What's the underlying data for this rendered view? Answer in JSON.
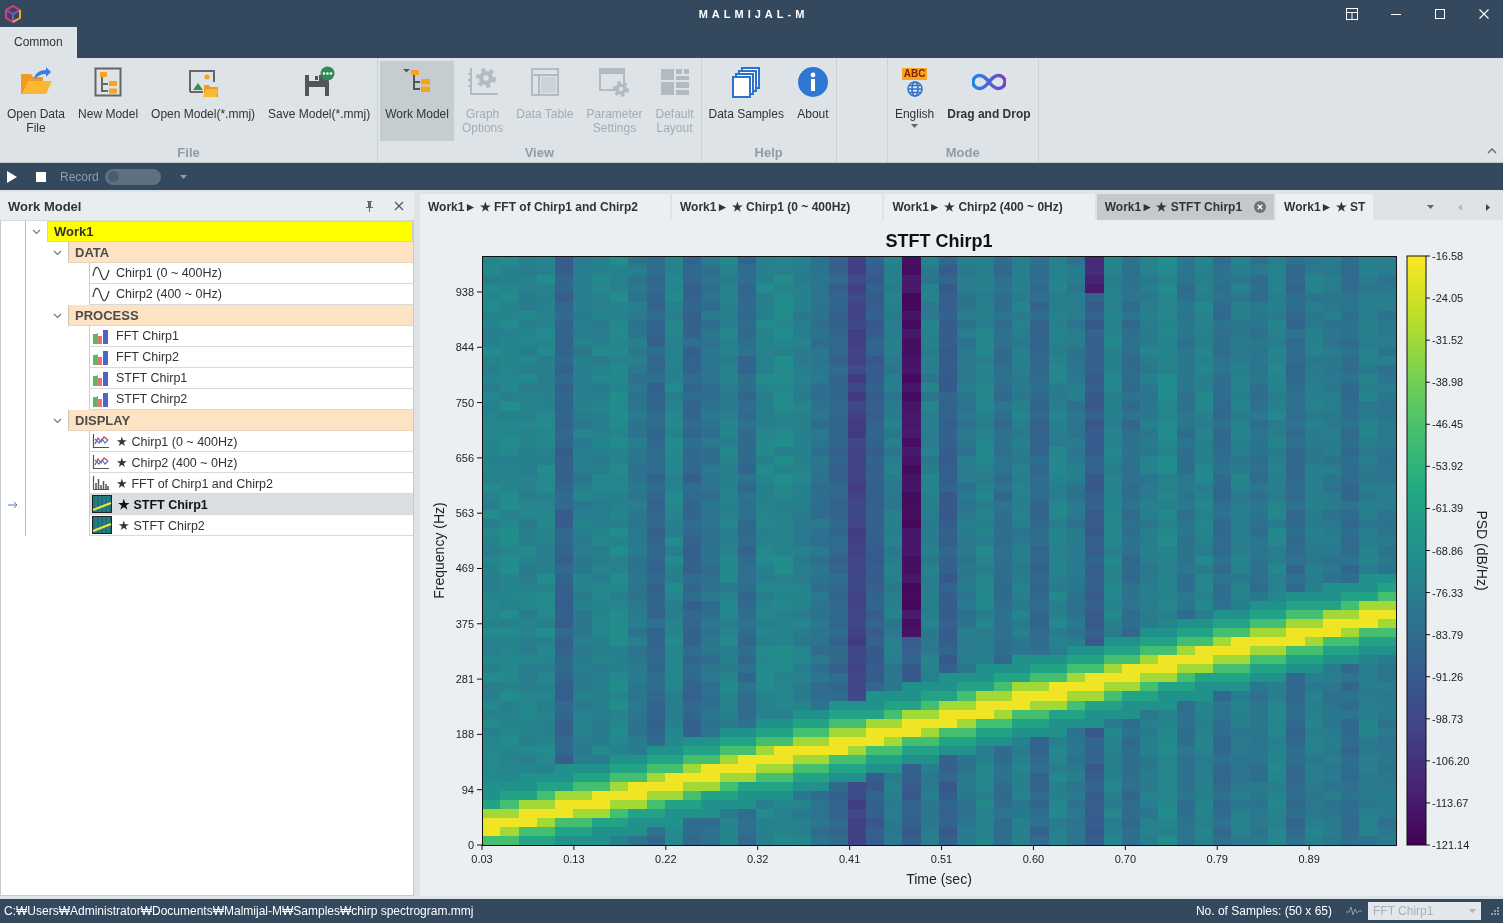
{
  "window": {
    "title": "MALMIJAL-M"
  },
  "ribbon": {
    "tabs": [
      {
        "label": "Common",
        "selected": true
      }
    ],
    "groups": [
      {
        "label": "File",
        "buttons": [
          {
            "label": "Open Data\nFile",
            "kind": "button",
            "checked": false,
            "disabled": false
          },
          {
            "label": "New Model",
            "kind": "button",
            "checked": false,
            "disabled": false
          },
          {
            "label": "Open Model(*.mmj)",
            "kind": "button",
            "checked": false,
            "disabled": false
          },
          {
            "label": "Save Model(*.mmj)",
            "kind": "button",
            "checked": false,
            "disabled": false
          }
        ]
      },
      {
        "label": "View",
        "buttons": [
          {
            "label": "Work Model",
            "kind": "button",
            "checked": true,
            "disabled": false
          },
          {
            "label": "Graph\nOptions",
            "kind": "button",
            "checked": false,
            "disabled": true
          },
          {
            "label": "Data Table",
            "kind": "button",
            "checked": false,
            "disabled": true
          },
          {
            "label": "Parameter\nSettings",
            "kind": "button",
            "checked": false,
            "disabled": true
          },
          {
            "label": "Default\nLayout",
            "kind": "button",
            "checked": false,
            "disabled": true
          }
        ]
      },
      {
        "label": "Help",
        "buttons": [
          {
            "label": "Data Samples",
            "kind": "button",
            "checked": false,
            "disabled": false
          },
          {
            "label": "About",
            "kind": "button",
            "checked": false,
            "disabled": false
          }
        ]
      },
      {
        "label": "Mode",
        "buttons": [
          {
            "label": "English",
            "kind": "dropdown",
            "badge": "ABC",
            "checked": false,
            "disabled": false
          },
          {
            "label": "Drag and Drop",
            "kind": "toggle",
            "checked": true,
            "disabled": false
          }
        ]
      }
    ]
  },
  "toolbar": {
    "record": {
      "label": "Record",
      "on": false
    }
  },
  "work_model_panel": {
    "title": "Work Model",
    "tree": [
      {
        "label": "Work1",
        "kind": "root",
        "expanded": true,
        "selected": false,
        "children": [
          {
            "label": "DATA",
            "kind": "category",
            "expanded": true,
            "selected": false,
            "children": [
              {
                "label": "Chirp1 (0 ~ 400Hz)",
                "kind": "signal",
                "selected": false
              },
              {
                "label": "Chirp2 (400 ~ 0Hz)",
                "kind": "signal",
                "selected": false
              }
            ]
          },
          {
            "label": "PROCESS",
            "kind": "category",
            "expanded": true,
            "selected": false,
            "children": [
              {
                "label": "FFT Chirp1",
                "kind": "process",
                "selected": false
              },
              {
                "label": "FFT Chirp2",
                "kind": "process",
                "selected": false
              },
              {
                "label": "STFT Chirp1",
                "kind": "process",
                "selected": false
              },
              {
                "label": "STFT Chirp2",
                "kind": "process",
                "selected": false
              }
            ]
          },
          {
            "label": "DISPLAY",
            "kind": "category",
            "expanded": true,
            "selected": false,
            "children": [
              {
                "label": "★ Chirp1 (0 ~ 400Hz)",
                "kind": "line-plot",
                "selected": false
              },
              {
                "label": "★ Chirp2 (400 ~ 0Hz)",
                "kind": "line-plot",
                "selected": false
              },
              {
                "label": "★ FFT of Chirp1 and Chirp2",
                "kind": "spectrum",
                "selected": false
              },
              {
                "label": "★ STFT Chirp1",
                "kind": "spectrogram",
                "selected": true
              },
              {
                "label": "★ STFT Chirp2",
                "kind": "spectrogram",
                "selected": false
              }
            ]
          }
        ]
      }
    ]
  },
  "document_tabs": [
    {
      "label": "Work1► ★ FFT of Chirp1 and Chirp2",
      "selected": false
    },
    {
      "label": "Work1► ★ Chirp1 (0 ~ 400Hz)",
      "selected": false
    },
    {
      "label": "Work1► ★ Chirp2 (400 ~ 0Hz)",
      "selected": false
    },
    {
      "label": "Work1► ★ STFT Chirp1",
      "selected": true
    },
    {
      "label": "Work1► ★ ST",
      "selected": false
    }
  ],
  "plot": {
    "title": "STFT Chirp1",
    "xlabel": "Time (sec)",
    "ylabel": "Frequency (Hz)",
    "xticks": [
      "0.03",
      "0.13",
      "0.22",
      "0.32",
      "0.41",
      "0.51",
      "0.60",
      "0.70",
      "0.79",
      "0.89"
    ],
    "yticks": [
      "938",
      "844",
      "750",
      "656",
      "563",
      "469",
      "375",
      "281",
      "188",
      "94",
      "0"
    ],
    "colorbar": {
      "label": "PSD (dB/Hz)",
      "ticks": [
        "-16.58",
        "-24.05",
        "-31.52",
        "-38.98",
        "-46.45",
        "-53.92",
        "-61.39",
        "-68.86",
        "-76.33",
        "-83.79",
        "-91.26",
        "-98.73",
        "-106.20",
        "-113.67",
        "-121.14"
      ]
    }
  },
  "status_bar": {
    "path": "C:₩Users₩Administrator₩Documents₩Malmijal-M₩Samples₩chirp spectrogram.mmj",
    "sample_count": "No. of Samples: (50 x 65)",
    "display_select": {
      "value": "FFT Chirp1",
      "disabled": true
    }
  }
}
